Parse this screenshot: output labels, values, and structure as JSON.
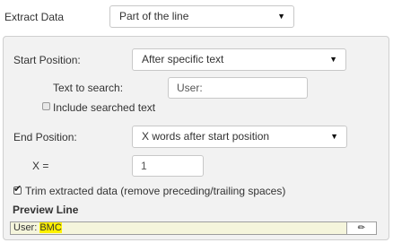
{
  "extract_data": {
    "label": "Extract Data",
    "selected": "Part of the line"
  },
  "start_position": {
    "label": "Start Position:",
    "selected": "After specific text",
    "search_label": "Text to search:",
    "search_value": "User:",
    "include_label": "Include searched text",
    "include_checked": false
  },
  "end_position": {
    "label": "End Position:",
    "selected": "X words after start position",
    "x_label": "X =",
    "x_value": "1"
  },
  "trim": {
    "label": "Trim extracted data (remove preceding/trailing spaces)",
    "checked": true
  },
  "preview": {
    "title": "Preview Line",
    "prefix": "User: ",
    "highlight": "BMC",
    "highlight_color": "#fff200",
    "background_color": "#f5f5dc"
  },
  "icons": {
    "dropdown": "caret-down-icon",
    "checkbox_tick": "check-icon",
    "edit": "pencil-icon"
  }
}
